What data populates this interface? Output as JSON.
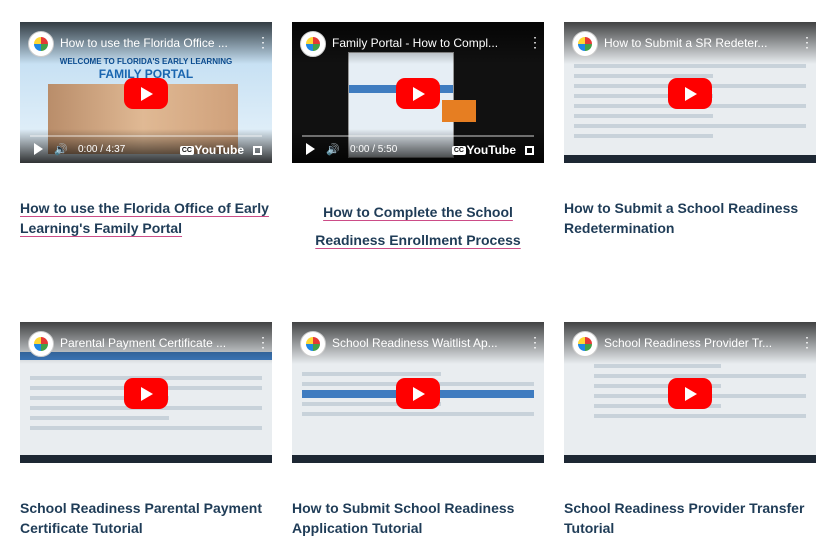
{
  "videos": [
    {
      "title": "How to use the Florida Office ...",
      "caption": "How to use the Florida Office of Early Learning's Family Portal",
      "time": "0:00 / 4:37",
      "portal_line1": "WELCOME TO FLORIDA'S EARLY LEARNING",
      "portal_line2": "FAMILY PORTAL",
      "cc": "CC",
      "brand": "YouTube"
    },
    {
      "title": "Family Portal - How to Compl...",
      "caption_line1": "How to Complete the School",
      "caption_line2": "Readiness Enrollment Process",
      "time": "0:00 / 5:50",
      "cc": "CC",
      "brand": "YouTube"
    },
    {
      "title": "How to Submit a SR Redeter...",
      "caption": "How to Submit a School Readiness Redetermination"
    },
    {
      "title": "Parental Payment Certificate ...",
      "caption": "School Readiness Parental Payment Certificate Tutorial"
    },
    {
      "title": "School Readiness Waitlist Ap...",
      "caption": "How to Submit School Readiness Application Tutorial"
    },
    {
      "title": "School Readiness Provider Tr...",
      "caption": "School Readiness Provider Transfer Tutorial"
    }
  ],
  "icons": {
    "play": "play-icon",
    "more": "more-vertical-icon",
    "volume": "volume-icon",
    "fullscreen": "fullscreen-icon",
    "channel": "channel-logo-icon"
  },
  "colors": {
    "caption_text": "#1f3c57",
    "link_underline": "#cc4c87",
    "play_button": "#ff0000"
  }
}
